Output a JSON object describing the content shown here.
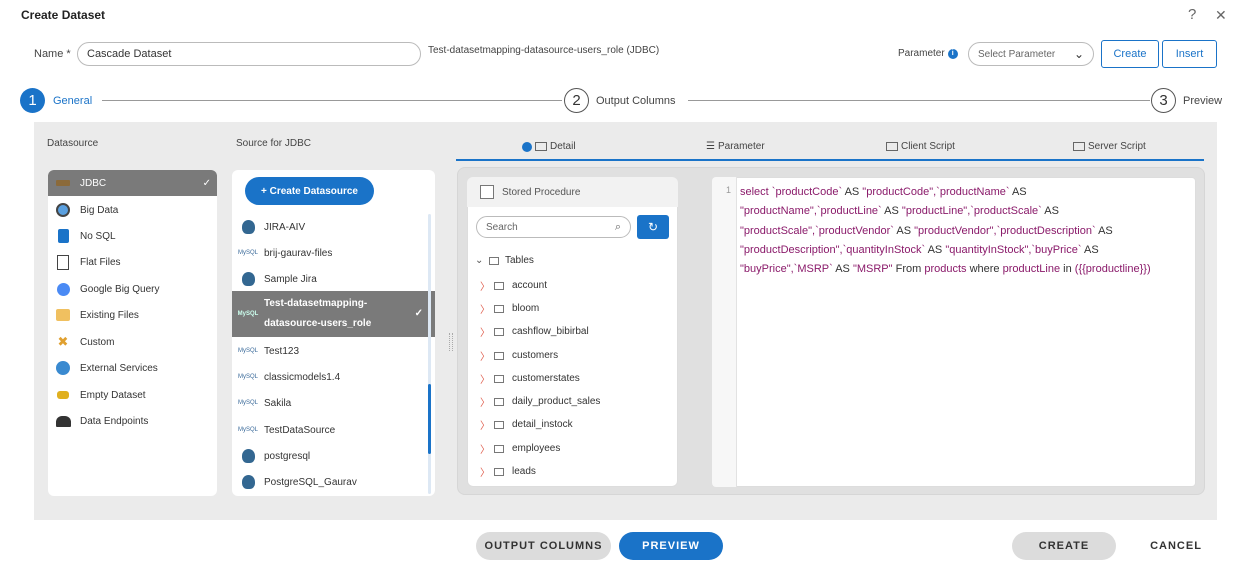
{
  "dialog": {
    "title": "Create Dataset",
    "help_icon": "help-icon",
    "close_icon": "close-icon"
  },
  "name_field": {
    "label": "Name",
    "required_mark": "*",
    "value": "Cascade Dataset",
    "source_info": "Test-datasetmapping-datasource-users_role (JDBC)"
  },
  "parameter": {
    "label": "Parameter",
    "placeholder": "Select Parameter",
    "create_label": "Create",
    "insert_label": "Insert"
  },
  "steps": [
    {
      "number": "1",
      "label": "General"
    },
    {
      "number": "2",
      "label": "Output Columns"
    },
    {
      "number": "3",
      "label": "Preview"
    }
  ],
  "datasource": {
    "heading": "Datasource",
    "items": [
      {
        "label": "JDBC",
        "icon": "jdbc-icon",
        "selected": true
      },
      {
        "label": "Big Data",
        "icon": "big-data-icon"
      },
      {
        "label": "No SQL",
        "icon": "nosql-icon"
      },
      {
        "label": "Flat Files",
        "icon": "flat-files-icon"
      },
      {
        "label": "Google Big Query",
        "icon": "big-query-icon"
      },
      {
        "label": "Existing Files",
        "icon": "existing-files-icon"
      },
      {
        "label": "Custom",
        "icon": "custom-icon"
      },
      {
        "label": "External Services",
        "icon": "globe-icon"
      },
      {
        "label": "Empty Dataset",
        "icon": "empty-dataset-icon"
      },
      {
        "label": "Data Endpoints",
        "icon": "data-endpoints-icon"
      }
    ]
  },
  "source": {
    "heading": "Source for JDBC",
    "create_label": "+ Create Datasource",
    "items": [
      {
        "label": "JIRA-AIV",
        "icon": "postgres-icon"
      },
      {
        "label": "brij-gaurav-files",
        "icon": "mysql-icon"
      },
      {
        "label": "Sample Jira",
        "icon": "postgres-icon"
      },
      {
        "label": "Test-datasetmapping-",
        "label2": "datasource-users_role",
        "icon": "mysql-icon",
        "selected": true
      },
      {
        "label": "Test123",
        "icon": "mysql-icon"
      },
      {
        "label": "classicmodels1.4",
        "icon": "mysql-icon"
      },
      {
        "label": "Sakila",
        "icon": "mysql-icon"
      },
      {
        "label": "TestDataSource",
        "icon": "mysql-icon"
      },
      {
        "label": "postgresql",
        "icon": "postgres-icon"
      },
      {
        "label": "PostgreSQL_Gaurav",
        "icon": "postgres-icon"
      }
    ]
  },
  "tabs": [
    {
      "label": "Detail",
      "icon": "detail-icon",
      "active": true
    },
    {
      "label": "Parameter",
      "icon": "parameter-icon"
    },
    {
      "label": "Client Script",
      "icon": "client-script-icon"
    },
    {
      "label": "Server Script",
      "icon": "server-script-icon"
    }
  ],
  "tree": {
    "stored_procedure_label": "Stored Procedure",
    "search_placeholder": "Search",
    "tables_label": "Tables",
    "tables": [
      "account",
      "bloom",
      "cashflow_bibirbal",
      "customers",
      "customerstates",
      "daily_product_sales",
      "detail_instock",
      "employees",
      "leads"
    ]
  },
  "editor": {
    "line_number": "1",
    "lines": [
      "select `productCode` AS \"productCode\",`productName` AS",
      "\"productName\",`productLine` AS \"productLine\",`productScale` AS",
      "\"productScale\",`productVendor` AS \"productVendor\",`productDescription` AS",
      "\"productDescription\",`quantityInStock` AS \"quantityInStock\",`buyPrice` AS",
      "\"buyPrice\",`MSRP` AS \"MSRP\" From products where productLine in ({{productline}})"
    ]
  },
  "footer": {
    "output_columns": "OUTPUT COLUMNS",
    "preview": "PREVIEW",
    "create": "CREATE",
    "cancel": "CANCEL"
  },
  "colors": {
    "accent": "#1a73c8",
    "selected_bg": "#7a7a7a",
    "panel_bg": "#ebebeb"
  }
}
